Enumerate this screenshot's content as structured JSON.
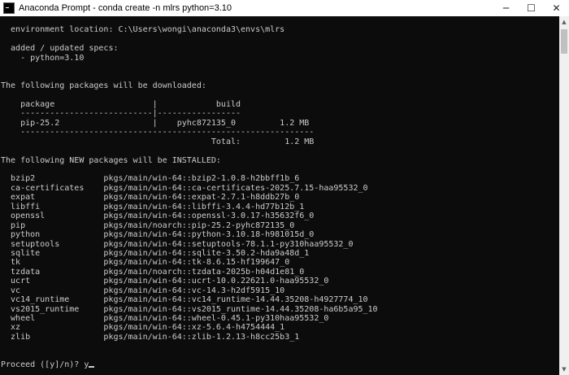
{
  "window": {
    "title": "Anaconda Prompt - conda  create -n mlrs python=3.10",
    "controls": {
      "minimize": "─",
      "maximize": "☐",
      "close": "✕"
    }
  },
  "console": {
    "lines": [
      "",
      "  environment location: C:\\Users\\wongi\\anaconda3\\envs\\mlrs",
      "",
      "  added / updated specs:",
      "    - python=3.10",
      "",
      "",
      "The following packages will be downloaded:",
      "",
      "    package                    |            build",
      "    ---------------------------|-----------------",
      "    pip-25.2                   |    pyhc872135_0         1.2 MB",
      "    ------------------------------------------------------------",
      "                                           Total:         1.2 MB",
      "",
      "The following NEW packages will be INSTALLED:",
      "",
      "  bzip2              pkgs/main/win-64::bzip2-1.0.8-h2bbff1b_6",
      "  ca-certificates    pkgs/main/win-64::ca-certificates-2025.7.15-haa95532_0",
      "  expat              pkgs/main/win-64::expat-2.7.1-h8ddb27b_0",
      "  libffi             pkgs/main/win-64::libffi-3.4.4-hd77b12b_1",
      "  openssl            pkgs/main/win-64::openssl-3.0.17-h35632f6_0",
      "  pip                pkgs/main/noarch::pip-25.2-pyhc872135_0",
      "  python             pkgs/main/win-64::python-3.10.18-h981015d_0",
      "  setuptools         pkgs/main/win-64::setuptools-78.1.1-py310haa95532_0",
      "  sqlite             pkgs/main/win-64::sqlite-3.50.2-hda9a48d_1",
      "  tk                 pkgs/main/win-64::tk-8.6.15-hf199647_0",
      "  tzdata             pkgs/main/noarch::tzdata-2025b-h04d1e81_0",
      "  ucrt               pkgs/main/win-64::ucrt-10.0.22621.0-haa95532_0",
      "  vc                 pkgs/main/win-64::vc-14.3-h2df5915_10",
      "  vc14_runtime       pkgs/main/win-64::vc14_runtime-14.44.35208-h4927774_10",
      "  vs2015_runtime     pkgs/main/win-64::vs2015_runtime-14.44.35208-ha6b5a95_10",
      "  wheel              pkgs/main/win-64::wheel-0.45.1-py310haa95532_0",
      "  xz                 pkgs/main/win-64::xz-5.6.4-h4754444_1",
      "  zlib               pkgs/main/win-64::zlib-1.2.13-h8cc25b3_1",
      "",
      "",
      "Proceed ([y]/n)? y"
    ]
  },
  "scrollbar": {
    "up": "▲",
    "down": "▼"
  }
}
